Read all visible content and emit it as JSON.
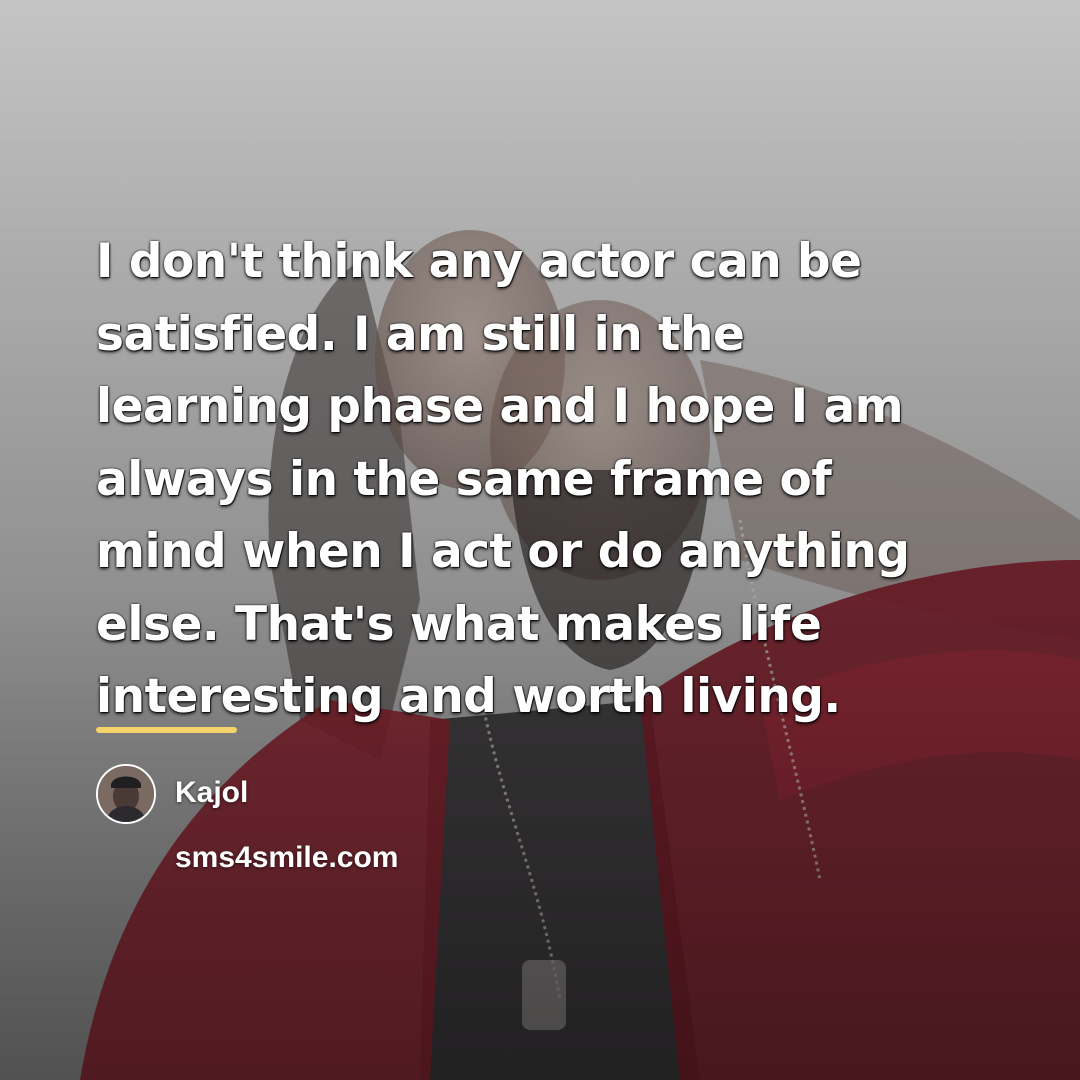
{
  "quote": {
    "lines": [
      "I don't think any actor can be",
      "satisfied. I am still in the",
      "learning phase and I hope I am",
      "always in the same frame of",
      "mind when I act or do anything",
      "else. That's what makes life",
      "interesting and worth living."
    ]
  },
  "author": {
    "name": "Kajol",
    "avatar_icon": "person-avatar-icon"
  },
  "site": {
    "url": "sms4smile.com"
  },
  "colors": {
    "accent_underline": "#f4d36a",
    "robe_red": "#7a1f2a",
    "text": "#ffffff"
  }
}
